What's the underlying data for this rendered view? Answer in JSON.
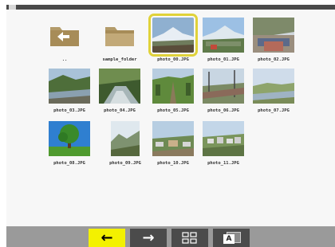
{
  "grid": {
    "items": [
      {
        "label": "..",
        "type": "folder-up"
      },
      {
        "label": "sample_folder",
        "type": "folder"
      },
      {
        "label": "photo_00.JPG",
        "type": "image",
        "selected": true
      },
      {
        "label": "photo_01.JPG",
        "type": "image"
      },
      {
        "label": "photo_02.JPG",
        "type": "image"
      },
      {
        "label": "photo_03.JPG",
        "type": "image"
      },
      {
        "label": "photo_04.JPG",
        "type": "image"
      },
      {
        "label": "photo_05.JPG",
        "type": "image"
      },
      {
        "label": "photo_06.JPG",
        "type": "image"
      },
      {
        "label": "photo_07.JPG",
        "type": "image"
      },
      {
        "label": "photo_08.JPG",
        "type": "image"
      },
      {
        "label": "photo_09.JPG",
        "type": "image"
      },
      {
        "label": "photo_10.JPG",
        "type": "image"
      },
      {
        "label": "photo_11.JPG",
        "type": "image"
      }
    ]
  },
  "navbar": {
    "buttons": [
      {
        "name": "back",
        "icon": "arrow-left-icon",
        "glyph": "←",
        "active": true
      },
      {
        "name": "forward",
        "icon": "arrow-right-icon",
        "glyph": "→",
        "active": false
      },
      {
        "name": "grid-view",
        "icon": "grid-icon",
        "active": false
      },
      {
        "name": "stack-view",
        "icon": "stack-a-icon",
        "glyph": "A",
        "active": false
      }
    ]
  },
  "colors": {
    "selection": "#e0d23a",
    "nav_active": "#f3f100",
    "folder": "#b39b6a"
  }
}
